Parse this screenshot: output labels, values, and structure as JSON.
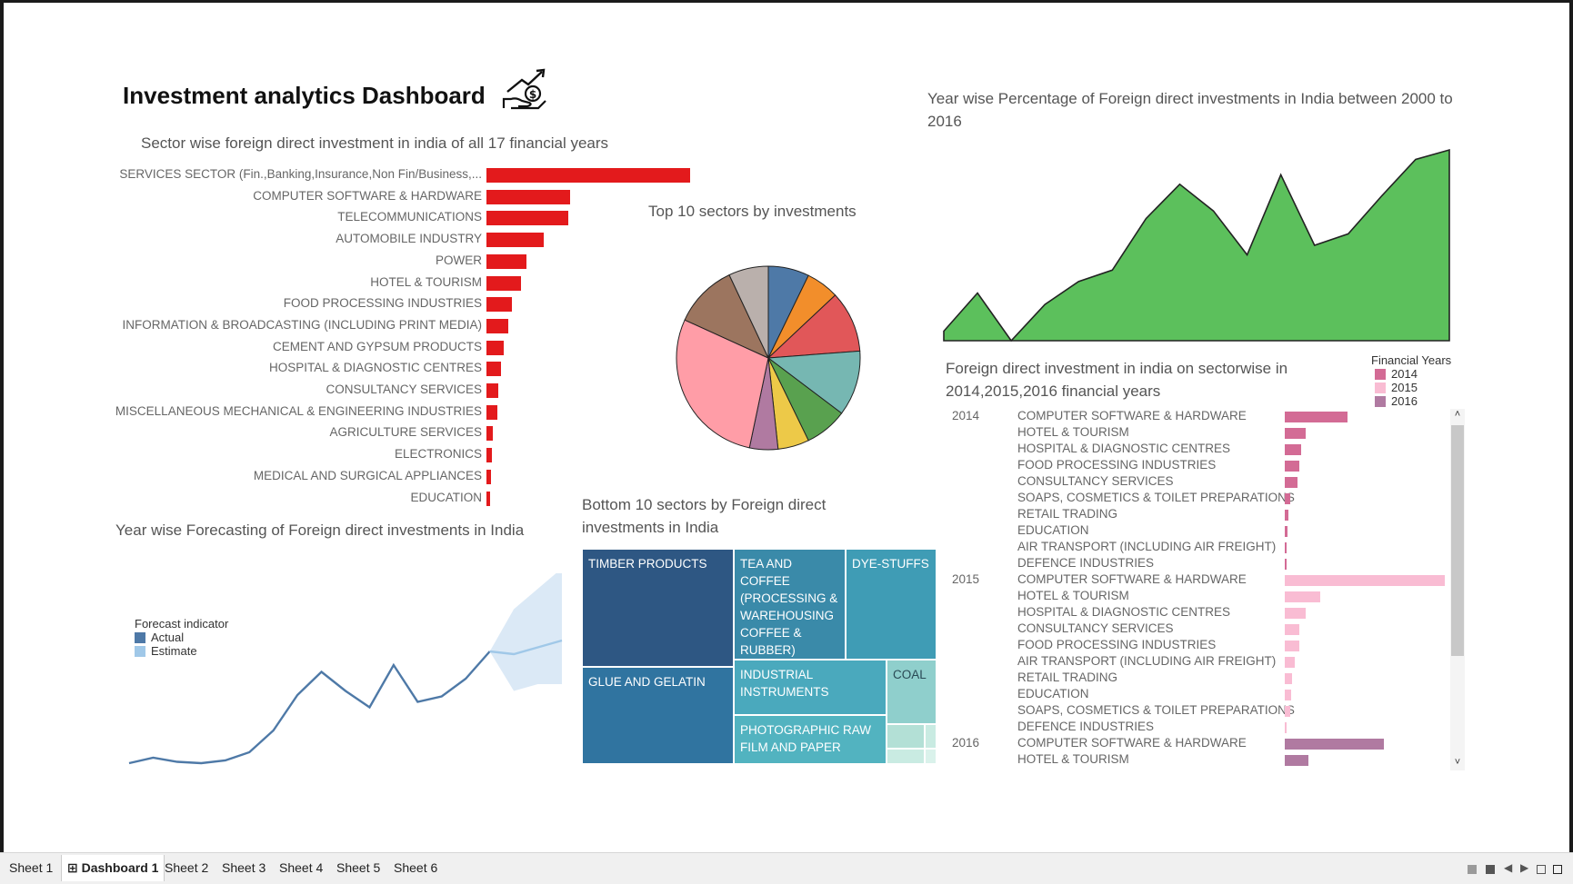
{
  "dashboard": {
    "title": "Investment analytics Dashboard",
    "icon": "money-hand-growth-icon"
  },
  "sector_chart": {
    "title": "Sector wise foreign direct investment in india of all 17 financial years",
    "color": "#e31a1c",
    "rows": [
      {
        "label": "SERVICES SECTOR (Fin.,Banking,Insurance,Non Fin/Business,...",
        "value": 1.0
      },
      {
        "label": "COMPUTER SOFTWARE & HARDWARE",
        "value": 0.41
      },
      {
        "label": "TELECOMMUNICATIONS",
        "value": 0.4
      },
      {
        "label": "AUTOMOBILE INDUSTRY",
        "value": 0.28
      },
      {
        "label": "POWER",
        "value": 0.195
      },
      {
        "label": "HOTEL & TOURISM",
        "value": 0.17
      },
      {
        "label": "FOOD PROCESSING INDUSTRIES",
        "value": 0.125
      },
      {
        "label": "INFORMATION & BROADCASTING (INCLUDING PRINT MEDIA)",
        "value": 0.105
      },
      {
        "label": "CEMENT AND GYPSUM PRODUCTS",
        "value": 0.085
      },
      {
        "label": "HOSPITAL & DIAGNOSTIC CENTRES",
        "value": 0.07
      },
      {
        "label": "CONSULTANCY SERVICES",
        "value": 0.06
      },
      {
        "label": "MISCELLANEOUS MECHANICAL & ENGINEERING INDUSTRIES",
        "value": 0.055
      },
      {
        "label": "AGRICULTURE SERVICES",
        "value": 0.03
      },
      {
        "label": "ELECTRONICS",
        "value": 0.025
      },
      {
        "label": "MEDICAL AND SURGICAL APPLIANCES",
        "value": 0.022
      },
      {
        "label": "EDUCATION",
        "value": 0.02
      }
    ]
  },
  "pie_chart": {
    "title": "Top 10 sectors by investments",
    "slices": [
      {
        "value": 7.2,
        "color": "#4e79a7"
      },
      {
        "value": 5.8,
        "color": "#f28e2b"
      },
      {
        "value": 10.8,
        "color": "#e15759"
      },
      {
        "value": 11.5,
        "color": "#76b7b2"
      },
      {
        "value": 7.5,
        "color": "#59a14f"
      },
      {
        "value": 5.5,
        "color": "#edc948"
      },
      {
        "value": 5.0,
        "color": "#b07aa1"
      },
      {
        "value": 28.5,
        "color": "#ff9da7"
      },
      {
        "value": 11.2,
        "color": "#9c755f"
      },
      {
        "value": 7.0,
        "color": "#bab0ac"
      }
    ]
  },
  "area_chart": {
    "title": "Year wise Percentage of Foreign direct investments in India between 2000 to 2016",
    "color": "#5cc05c",
    "values": [
      0.05,
      0.25,
      0.0,
      0.19,
      0.31,
      0.37,
      0.64,
      0.82,
      0.68,
      0.45,
      0.87,
      0.5,
      0.56,
      0.76,
      0.95,
      1.0
    ]
  },
  "forecast_chart": {
    "title": "Year wise Forecasting of Foreign direct investments in India",
    "legend_title": "Forecast indicator",
    "legend": [
      {
        "label": "Actual",
        "color": "#4e79a7"
      },
      {
        "label": "Estimate",
        "color": "#a0c8e8"
      }
    ],
    "actual": [
      0.02,
      0.06,
      0.03,
      0.02,
      0.04,
      0.1,
      0.26,
      0.52,
      0.69,
      0.55,
      0.43,
      0.74,
      0.47,
      0.51,
      0.64,
      0.84
    ],
    "estimate": [
      0.84,
      0.82,
      0.87,
      0.92
    ],
    "band_upper": [
      0.84,
      1.15,
      1.3,
      1.45
    ],
    "band_lower": [
      0.84,
      0.55,
      0.6,
      0.6
    ]
  },
  "treemap": {
    "title": "Bottom 10 sectors by Foreign direct investments in India",
    "cells": [
      {
        "label": "TIMBER PRODUCTS"
      },
      {
        "label": "GLUE AND GELATIN"
      },
      {
        "label": "TEA AND COFFEE (PROCESSING & WAREHOUSING COFFEE & RUBBER)"
      },
      {
        "label": "DYE-STUFFS"
      },
      {
        "label": "INDUSTRIAL INSTRUMENTS"
      },
      {
        "label": "COAL"
      },
      {
        "label": "PHOTOGRAPHIC RAW FILM AND PAPER"
      }
    ]
  },
  "sector_years": {
    "title": "Foreign direct investment in india on sectorwise in 2014,2015,2016 financial years",
    "legend_title": "Financial Years",
    "legend": [
      {
        "label": "2014",
        "color": "#d36b95"
      },
      {
        "label": "2015",
        "color": "#f9bcd3"
      },
      {
        "label": "2016",
        "color": "#b07aa1"
      }
    ],
    "groups": [
      {
        "year": "2014",
        "color": "#d36b95",
        "rows": [
          {
            "label": "COMPUTER SOFTWARE & HARDWARE",
            "value": 0.39
          },
          {
            "label": "HOTEL & TOURISM",
            "value": 0.13
          },
          {
            "label": "HOSPITAL & DIAGNOSTIC CENTRES",
            "value": 0.1
          },
          {
            "label": "FOOD PROCESSING INDUSTRIES",
            "value": 0.09
          },
          {
            "label": "CONSULTANCY SERVICES",
            "value": 0.08
          },
          {
            "label": "SOAPS, COSMETICS & TOILET PREPARATIONS",
            "value": 0.035
          },
          {
            "label": "RETAIL TRADING",
            "value": 0.025
          },
          {
            "label": "EDUCATION",
            "value": 0.015
          },
          {
            "label": "AIR TRANSPORT (INCLUDING AIR FREIGHT)",
            "value": 0.012
          },
          {
            "label": "DEFENCE INDUSTRIES",
            "value": 0.008
          }
        ]
      },
      {
        "year": "2015",
        "color": "#f9bcd3",
        "rows": [
          {
            "label": "COMPUTER SOFTWARE & HARDWARE",
            "value": 1.0
          },
          {
            "label": "HOTEL & TOURISM",
            "value": 0.22
          },
          {
            "label": "HOSPITAL & DIAGNOSTIC CENTRES",
            "value": 0.13
          },
          {
            "label": "CONSULTANCY SERVICES",
            "value": 0.09
          },
          {
            "label": "FOOD PROCESSING INDUSTRIES",
            "value": 0.09
          },
          {
            "label": "AIR TRANSPORT (INCLUDING AIR FREIGHT)",
            "value": 0.06
          },
          {
            "label": "RETAIL TRADING",
            "value": 0.045
          },
          {
            "label": "EDUCATION",
            "value": 0.04
          },
          {
            "label": "SOAPS, COSMETICS & TOILET PREPARATIONS",
            "value": 0.035
          },
          {
            "label": "DEFENCE INDUSTRIES",
            "value": 0.008
          }
        ]
      },
      {
        "year": "2016",
        "color": "#b07aa1",
        "rows": [
          {
            "label": "COMPUTER SOFTWARE & HARDWARE",
            "value": 0.62
          },
          {
            "label": "HOTEL & TOURISM",
            "value": 0.15
          }
        ]
      }
    ]
  },
  "tabs": [
    "Sheet 1",
    "Dashboard 1",
    "Sheet 2",
    "Sheet 3",
    "Sheet 4",
    "Sheet 5",
    "Sheet 6"
  ],
  "active_tab": "Dashboard 1"
}
